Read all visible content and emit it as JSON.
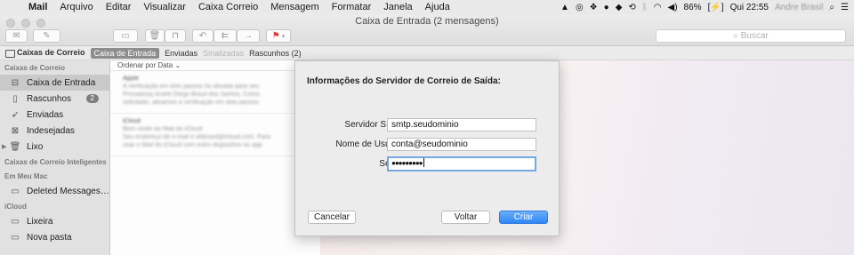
{
  "menubar": {
    "app": "Mail",
    "items": [
      "Arquivo",
      "Editar",
      "Visualizar",
      "Caixa Correio",
      "Mensagem",
      "Formatar",
      "Janela",
      "Ajuda"
    ],
    "battery": "86%",
    "clock": "Qui 22:55",
    "user": "Andre Brasil"
  },
  "window": {
    "title": "Caixa de Entrada (2 mensagens)",
    "search_placeholder": "Buscar"
  },
  "favorites": {
    "mailboxes": "Caixas de Correio",
    "inbox": "Caixa de Entrada",
    "sent": "Enviadas",
    "flagged": "Sinalizadas",
    "drafts": "Rascunhos (2)"
  },
  "sidebar": {
    "section1": "Caixas de Correio",
    "inbox": "Caixa de Entrada",
    "drafts": "Rascunhos",
    "drafts_badge": "2",
    "sent": "Enviadas",
    "junk": "Indesejadas",
    "trash": "Lixo",
    "section2": "Caixas de Correio Inteligentes",
    "section3": "Em Meu Mac",
    "deleted": "Deleted Messages…",
    "section4": "iCloud",
    "icloud_trash": "Lixeira",
    "new_folder": "Nova pasta"
  },
  "message_list": {
    "sort_label": "Ordenar por Data ⌄",
    "messages": [
      {
        "sender": "Apple",
        "subject": "A verificação em dois passos foi ativada para seu",
        "preview1": "Prezado(a) André Diego Brasil dos Santos, Como",
        "preview2": "solicitado, ativamos a verificação em dois passos"
      },
      {
        "sender": "iCloud",
        "subject": "Bem-vindo ao Mail do iCloud",
        "preview1": "Seu endereço de e-mail é ahbrasil@icloud.com. Para",
        "preview2": "usar o Mail do iCloud com outro dispositivo ou app"
      }
    ]
  },
  "dialog": {
    "title": "Informações do Servidor de Correio de Saída:",
    "smtp_label": "Servidor SMTP:",
    "smtp_value": "smtp.seudominio",
    "user_label": "Nome de Usuário:",
    "user_value": "conta@seudominio",
    "password_label": "Senha:",
    "password_value": "●●●●●●●●●",
    "cancel": "Cancelar",
    "back": "Voltar",
    "create": "Criar"
  }
}
